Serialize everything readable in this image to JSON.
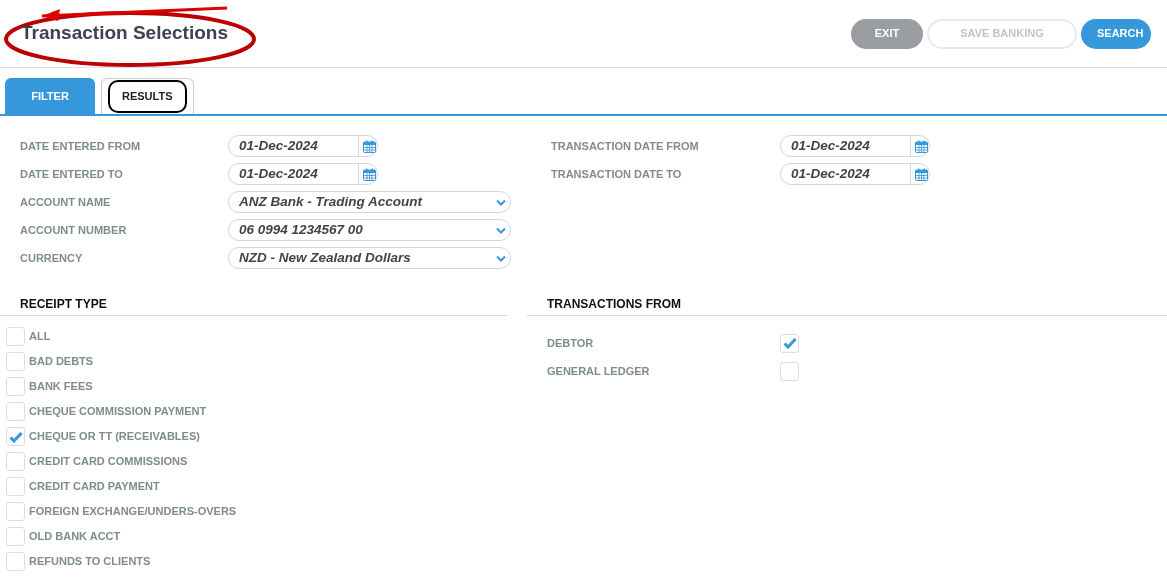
{
  "header": {
    "title": "Transaction Selections",
    "annotated": true
  },
  "buttons": [
    {
      "label": "EXIT",
      "kind": "secondary",
      "disabled": false
    },
    {
      "label": "SAVE BANKING",
      "kind": "outline",
      "disabled": true
    },
    {
      "label": "SEARCH",
      "kind": "primary",
      "disabled": false
    }
  ],
  "tabs": [
    {
      "label": "FILTER",
      "selected": true,
      "highlighted": false
    },
    {
      "label": "RESULTS",
      "selected": false,
      "highlighted": true
    }
  ],
  "left_fields": [
    {
      "label": "DATE ENTERED FROM",
      "kind": "date",
      "value": "01-Dec-2024"
    },
    {
      "label": "DATE ENTERED TO",
      "kind": "date",
      "value": "01-Dec-2024"
    },
    {
      "label": "ACCOUNT NAME",
      "kind": "select",
      "value": "ANZ Bank - Trading Account"
    },
    {
      "label": "ACCOUNT NUMBER",
      "kind": "select",
      "value": "06 0994 1234567 00"
    },
    {
      "label": "CURRENCY",
      "kind": "select",
      "value": "NZD - New Zealand Dollars"
    }
  ],
  "right_fields": [
    {
      "label": "TRANSACTION DATE FROM",
      "kind": "date",
      "value": "01-Dec-2024"
    },
    {
      "label": "TRANSACTION DATE TO",
      "kind": "date",
      "value": "01-Dec-2024"
    }
  ],
  "receipt_type": {
    "title": "RECEIPT TYPE",
    "items": [
      {
        "label": "ALL",
        "checked": false
      },
      {
        "label": "BAD DEBTS",
        "checked": false
      },
      {
        "label": "BANK FEES",
        "checked": false
      },
      {
        "label": "CHEQUE COMMISSION PAYMENT",
        "checked": false
      },
      {
        "label": "CHEQUE OR TT (RECEIVABLES)",
        "checked": true
      },
      {
        "label": "CREDIT CARD COMMISSIONS",
        "checked": false
      },
      {
        "label": "CREDIT CARD PAYMENT",
        "checked": false
      },
      {
        "label": "FOREIGN EXCHANGE/UNDERS-OVERS",
        "checked": false
      },
      {
        "label": "OLD BANK ACCT",
        "checked": false
      },
      {
        "label": "REFUNDS TO CLIENTS",
        "checked": false
      }
    ]
  },
  "transactions_from": {
    "title": "TRANSACTIONS FROM",
    "items": [
      {
        "label": "DEBTOR",
        "checked": true
      },
      {
        "label": "GENERAL LEDGER",
        "checked": false
      }
    ]
  }
}
